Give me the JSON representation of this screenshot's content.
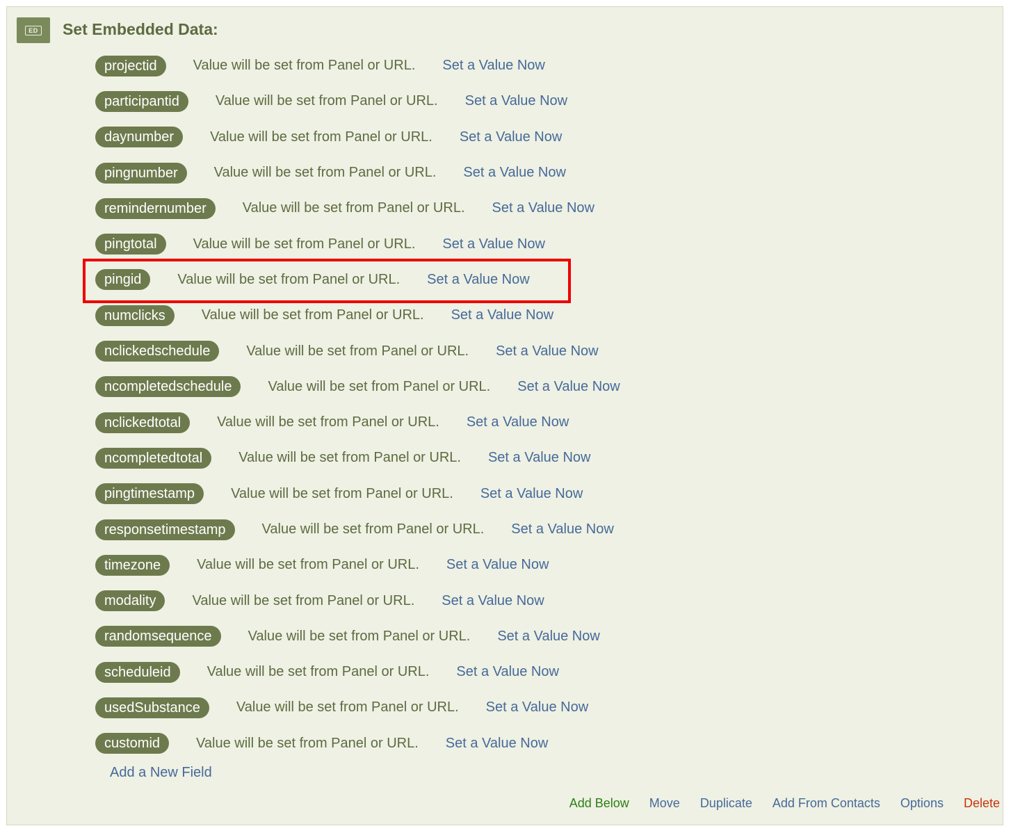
{
  "header": {
    "icon_label": "ED",
    "title": "Set Embedded Data:"
  },
  "fields": [
    {
      "name": "projectid",
      "description": "Value will be set from Panel or URL.",
      "action": "Set a Value Now"
    },
    {
      "name": "participantid",
      "description": "Value will be set from Panel or URL.",
      "action": "Set a Value Now"
    },
    {
      "name": "daynumber",
      "description": "Value will be set from Panel or URL.",
      "action": "Set a Value Now"
    },
    {
      "name": "pingnumber",
      "description": "Value will be set from Panel or URL.",
      "action": "Set a Value Now"
    },
    {
      "name": "remindernumber",
      "description": "Value will be set from Panel or URL.",
      "action": "Set a Value Now"
    },
    {
      "name": "pingtotal",
      "description": "Value will be set from Panel or URL.",
      "action": "Set a Value Now"
    },
    {
      "name": "pingid",
      "description": "Value will be set from Panel or URL.",
      "action": "Set a Value Now"
    },
    {
      "name": "numclicks",
      "description": "Value will be set from Panel or URL.",
      "action": "Set a Value Now"
    },
    {
      "name": "nclickedschedule",
      "description": "Value will be set from Panel or URL.",
      "action": "Set a Value Now"
    },
    {
      "name": "ncompletedschedule",
      "description": "Value will be set from Panel or URL.",
      "action": "Set a Value Now"
    },
    {
      "name": "nclickedtotal",
      "description": "Value will be set from Panel or URL.",
      "action": "Set a Value Now"
    },
    {
      "name": "ncompletedtotal",
      "description": "Value will be set from Panel or URL.",
      "action": "Set a Value Now"
    },
    {
      "name": "pingtimestamp",
      "description": "Value will be set from Panel or URL.",
      "action": "Set a Value Now"
    },
    {
      "name": "responsetimestamp",
      "description": "Value will be set from Panel or URL.",
      "action": "Set a Value Now"
    },
    {
      "name": "timezone",
      "description": "Value will be set from Panel or URL.",
      "action": "Set a Value Now"
    },
    {
      "name": "modality",
      "description": "Value will be set from Panel or URL.",
      "action": "Set a Value Now"
    },
    {
      "name": "randomsequence",
      "description": "Value will be set from Panel or URL.",
      "action": "Set a Value Now"
    },
    {
      "name": "scheduleid",
      "description": "Value will be set from Panel or URL.",
      "action": "Set a Value Now"
    },
    {
      "name": "usedSubstance",
      "description": "Value will be set from Panel or URL.",
      "action": "Set a Value Now"
    },
    {
      "name": "customid",
      "description": "Value will be set from Panel or URL.",
      "action": "Set a Value Now"
    }
  ],
  "add_field_label": "Add a New Field",
  "footer_actions": {
    "add_below": "Add Below",
    "move": "Move",
    "duplicate": "Duplicate",
    "add_from_contacts": "Add From Contacts",
    "options": "Options",
    "delete": "Delete"
  },
  "colors": {
    "panel_bg": "#eef1e3",
    "pill_bg": "#6d7a4d",
    "text_olive": "#5d6b42",
    "link_blue": "#47699a",
    "add_below_green": "#2e7d16",
    "delete_red": "#c8320e",
    "highlight_red": "#ee0000"
  }
}
